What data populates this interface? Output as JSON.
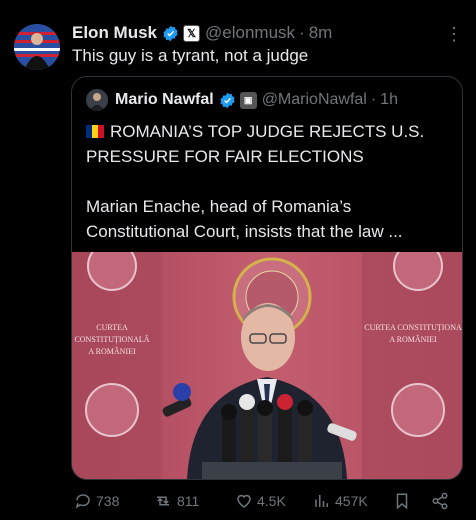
{
  "tweet": {
    "author_name": "Elon Musk",
    "handle": "@elonmusk",
    "time": "8m",
    "text": "This guy is a tyrant, not a judge"
  },
  "quoted": {
    "author_name": "Mario Nawfal",
    "handle": "@MarioNawfal",
    "time": "1h",
    "headline": "ROMANIA’S TOP JUDGE REJECTS U.S. PRESSURE FOR FAIR ELECTIONS",
    "body": "Marian Enache, head of Romania’s Constitutional Court, insists that the law ...",
    "photo_signs": {
      "left": "CURTEA CONSTITUȚIONALĂ A ROMÂNIEI",
      "left_line1": "CURTEA CONSTITUȚIONALĂ",
      "left_line2": "A ROMÂNIEI",
      "right_line1": "CURTEA CONSTITUȚIONA",
      "right_line2": "A ROMÂNIEI"
    }
  },
  "actions": {
    "replies": "738",
    "reposts": "811",
    "likes": "4.5K",
    "views": "457K"
  },
  "colors": {
    "background": "#000000",
    "text": "#e7e9ea",
    "muted": "#71767b",
    "verified": "#1d9bf0",
    "border": "#2f3336"
  }
}
